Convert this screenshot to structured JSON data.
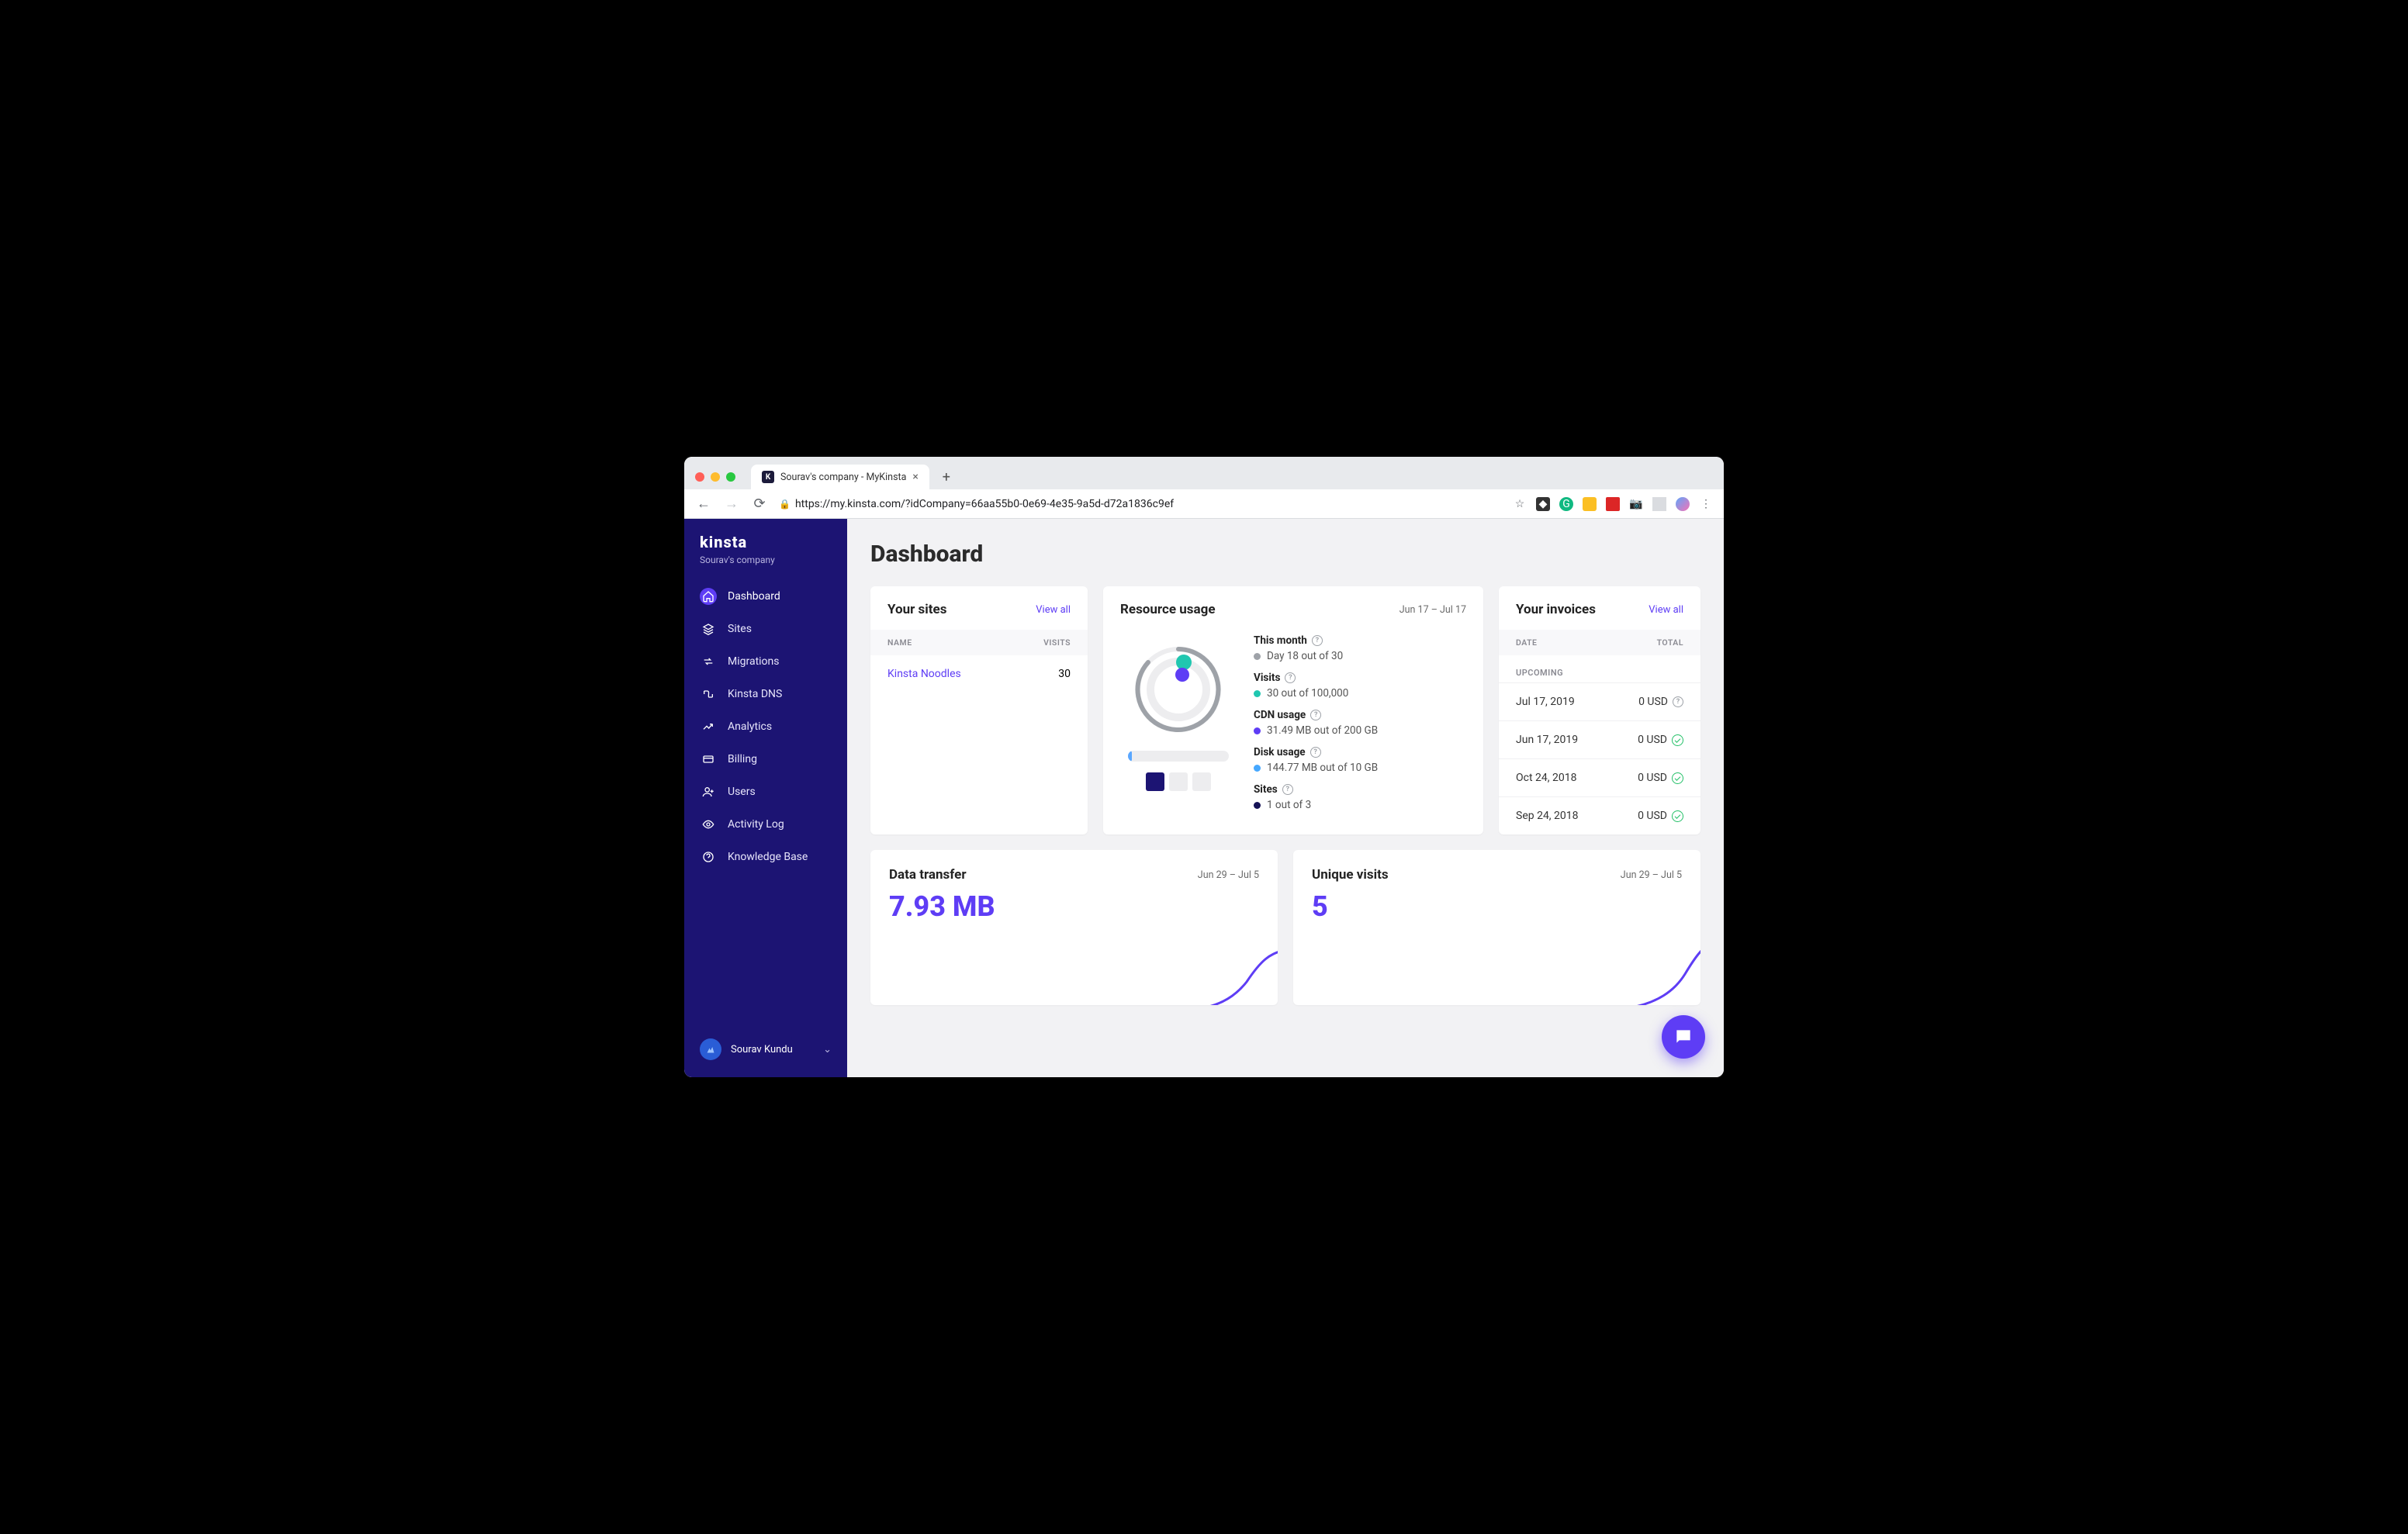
{
  "browser": {
    "tab_title": "Sourav's company - MyKinsta",
    "url": "https://my.kinsta.com/?idCompany=66aa55b0-0e69-4e35-9a5d-d72a1836c9ef"
  },
  "sidebar": {
    "logo": "kinsta",
    "company": "Sourav's company",
    "items": [
      {
        "label": "Dashboard",
        "icon": "home-icon",
        "active": true
      },
      {
        "label": "Sites",
        "icon": "stack-icon"
      },
      {
        "label": "Migrations",
        "icon": "swap-icon"
      },
      {
        "label": "Kinsta DNS",
        "icon": "route-icon"
      },
      {
        "label": "Analytics",
        "icon": "trend-icon"
      },
      {
        "label": "Billing",
        "icon": "card-icon"
      },
      {
        "label": "Users",
        "icon": "user-plus-icon"
      },
      {
        "label": "Activity Log",
        "icon": "eye-icon"
      },
      {
        "label": "Knowledge Base",
        "icon": "help-icon"
      }
    ],
    "user": "Sourav Kundu"
  },
  "page": {
    "title": "Dashboard"
  },
  "sites_card": {
    "title": "Your sites",
    "view_all": "View all",
    "col_name": "NAME",
    "col_visits": "VISITS",
    "rows": [
      {
        "name": "Kinsta Noodles",
        "visits": "30"
      }
    ]
  },
  "resource_card": {
    "title": "Resource usage",
    "range": "Jun 17 – Jul 17",
    "metrics": {
      "month_label": "This month",
      "month_value": "Day 18 out of 30",
      "visits_label": "Visits",
      "visits_value": "30 out of 100,000",
      "cdn_label": "CDN usage",
      "cdn_value": "31.49 MB out of 200 GB",
      "disk_label": "Disk usage",
      "disk_value": "144.77 MB out of 10 GB",
      "sites_label": "Sites",
      "sites_value": "1 out of 3"
    }
  },
  "invoices_card": {
    "title": "Your invoices",
    "view_all": "View all",
    "col_date": "DATE",
    "col_total": "TOTAL",
    "upcoming_label": "UPCOMING",
    "rows": [
      {
        "date": "Jul 17, 2019",
        "amount": "0 USD",
        "status": "pending"
      },
      {
        "date": "Jun 17, 2019",
        "amount": "0 USD",
        "status": "paid"
      },
      {
        "date": "Oct 24, 2018",
        "amount": "0 USD",
        "status": "paid"
      },
      {
        "date": "Sep 24, 2018",
        "amount": "0 USD",
        "status": "paid"
      }
    ]
  },
  "transfer_card": {
    "title": "Data transfer",
    "range": "Jun 29 – Jul 5",
    "value": "7.93 MB"
  },
  "visits_card": {
    "title": "Unique visits",
    "range": "Jun 29 – Jul 5",
    "value": "5"
  }
}
